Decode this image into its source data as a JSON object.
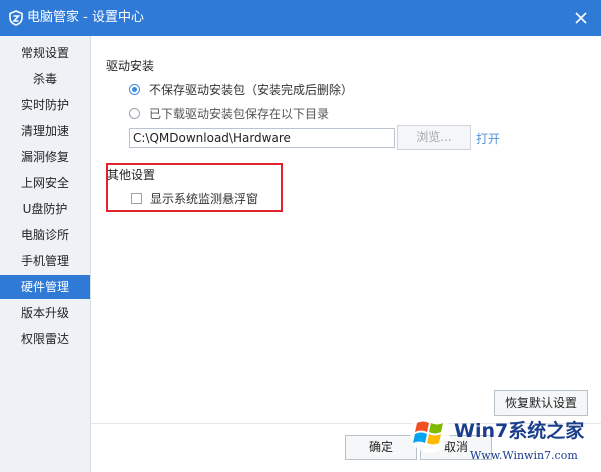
{
  "window": {
    "title": "电脑管家 - 设置中心",
    "accent_color": "#2f7ad6",
    "icons": {
      "app": "shield-icon",
      "close": "close-icon"
    }
  },
  "sidebar": {
    "items": [
      {
        "label": "常规设置",
        "active": false
      },
      {
        "label": "杀毒",
        "active": false
      },
      {
        "label": "实时防护",
        "active": false
      },
      {
        "label": "清理加速",
        "active": false
      },
      {
        "label": "漏洞修复",
        "active": false
      },
      {
        "label": "上网安全",
        "active": false
      },
      {
        "label": "U盘防护",
        "active": false
      },
      {
        "label": "电脑诊所",
        "active": false
      },
      {
        "label": "手机管理",
        "active": false
      },
      {
        "label": "硬件管理",
        "active": true
      },
      {
        "label": "版本升级",
        "active": false
      },
      {
        "label": "权限雷达",
        "active": false
      }
    ]
  },
  "driver_install": {
    "title": "驱动安装",
    "option_no_keep": "不保存驱动安装包（安装完成后删除）",
    "option_keep": "已下载驱动安装包保存在以下目录",
    "selected_option": "option_no_keep",
    "path_value": "C:\\QMDownload\\Hardware",
    "browse_label": "浏览...",
    "open_label": "打开"
  },
  "other_settings": {
    "title": "其他设置",
    "show_monitor_label": "显示系统监测悬浮窗",
    "show_monitor_checked": false,
    "highlight_color": "#e0242b"
  },
  "footer": {
    "restore_label": "恢复默认设置",
    "ok_label": "确定",
    "cancel_label": "取消"
  },
  "watermark": {
    "text": "Win7系统之家",
    "url": "Www.Winwin7.com"
  }
}
